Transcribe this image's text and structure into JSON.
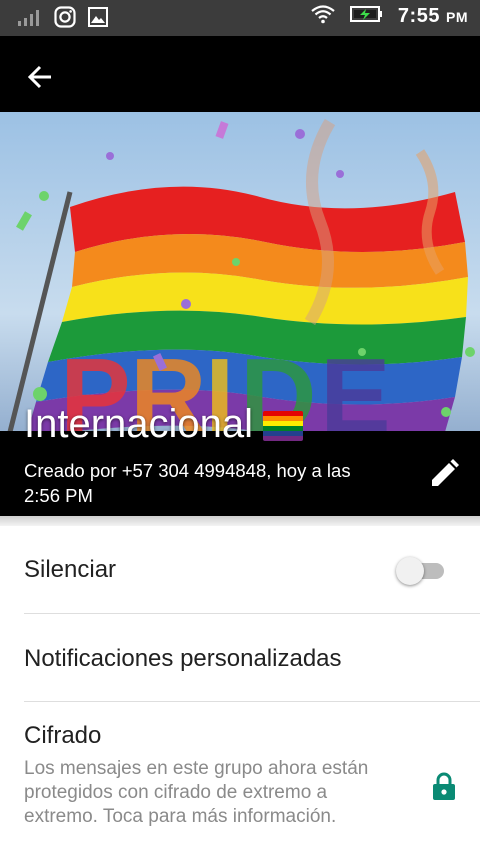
{
  "status_bar": {
    "icons": [
      "signal-icon",
      "instagram-icon",
      "gallery-icon",
      "wifi-icon",
      "battery-charging-icon"
    ],
    "time": "7:55",
    "ampm": "PM"
  },
  "app_bar": {
    "back_icon": "arrow-left-icon"
  },
  "group": {
    "name": "Internacional",
    "name_emoji": "rainbow-flag",
    "created_text": "Creado por +57 304 4994848, hoy a las 2:56 PM",
    "hero_banner_text": "PRIDE",
    "edit_icon": "pencil-icon"
  },
  "settings": {
    "mute_label": "Silenciar",
    "mute_on": false,
    "custom_notifications_label": "Notificaciones personalizadas",
    "encryption_title": "Cifrado",
    "encryption_desc": "Los mensajes en este grupo ahora están protegidos con cifrado de extremo a extremo. Toca para más información.",
    "lock_icon": "lock-icon"
  },
  "colors": {
    "status_bar": "#3c3c3c",
    "app_bar": "#000000",
    "lock": "#0a8a74",
    "flag": [
      "#e40303",
      "#ff8c00",
      "#ffed00",
      "#008026",
      "#24408e",
      "#732982"
    ]
  }
}
